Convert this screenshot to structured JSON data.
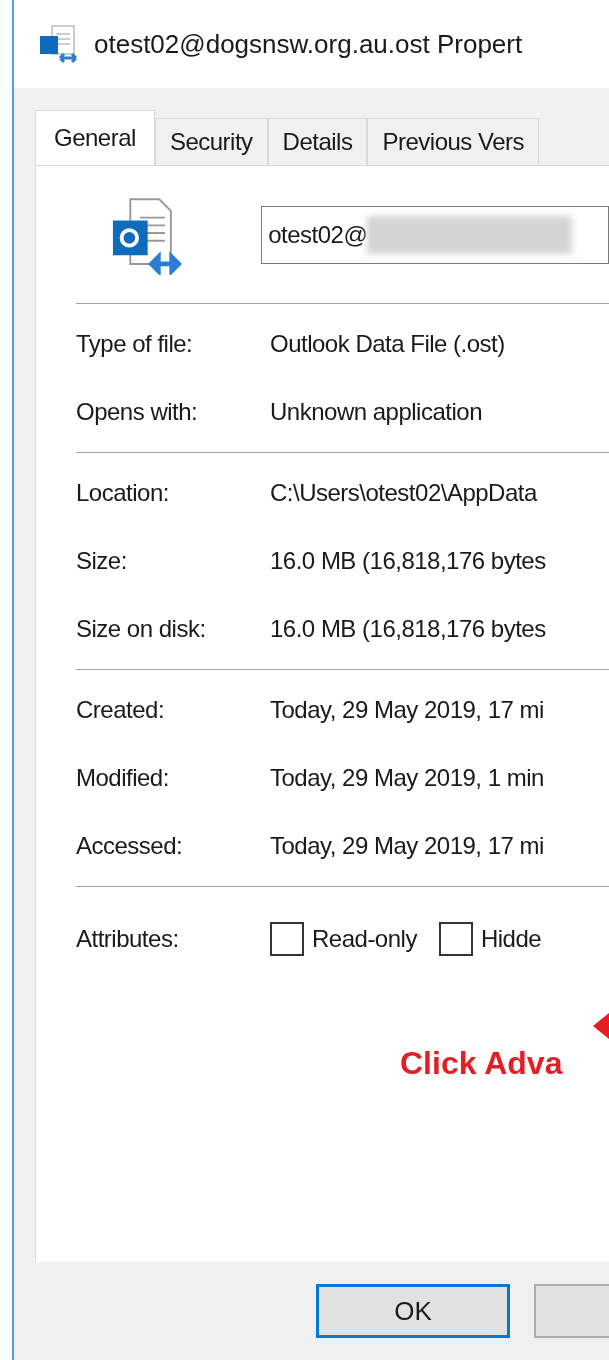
{
  "window": {
    "title": "otest02@dogsnsw.org.au.ost Propert"
  },
  "tabs": [
    {
      "label": "General",
      "selected": true
    },
    {
      "label": "Security",
      "selected": false
    },
    {
      "label": "Details",
      "selected": false
    },
    {
      "label": "Previous Vers",
      "selected": false
    }
  ],
  "name_field": {
    "value": "otest02@"
  },
  "groups": [
    [
      {
        "label": "Type of file:",
        "value": "Outlook Data File (.ost)"
      },
      {
        "label": "Opens with:",
        "value": "Unknown application"
      }
    ],
    [
      {
        "label": "Location:",
        "value": "C:\\Users\\otest02\\AppData"
      },
      {
        "label": "Size:",
        "value": "16.0 MB (16,818,176 bytes"
      },
      {
        "label": "Size on disk:",
        "value": "16.0 MB (16,818,176 bytes"
      }
    ],
    [
      {
        "label": "Created:",
        "value": "Today, 29 May 2019, 17 mi"
      },
      {
        "label": "Modified:",
        "value": "Today, 29 May 2019, 1 min"
      },
      {
        "label": "Accessed:",
        "value": "Today, 29 May 2019, 17 mi"
      }
    ]
  ],
  "attributes": {
    "label": "Attributes:",
    "options": [
      {
        "label": "Read-only",
        "checked": false
      },
      {
        "label": "Hidde",
        "checked": false
      }
    ]
  },
  "annotation": {
    "text": "Click Adva"
  },
  "buttons": [
    {
      "label": "OK",
      "default": true
    },
    {
      "default": false
    }
  ]
}
